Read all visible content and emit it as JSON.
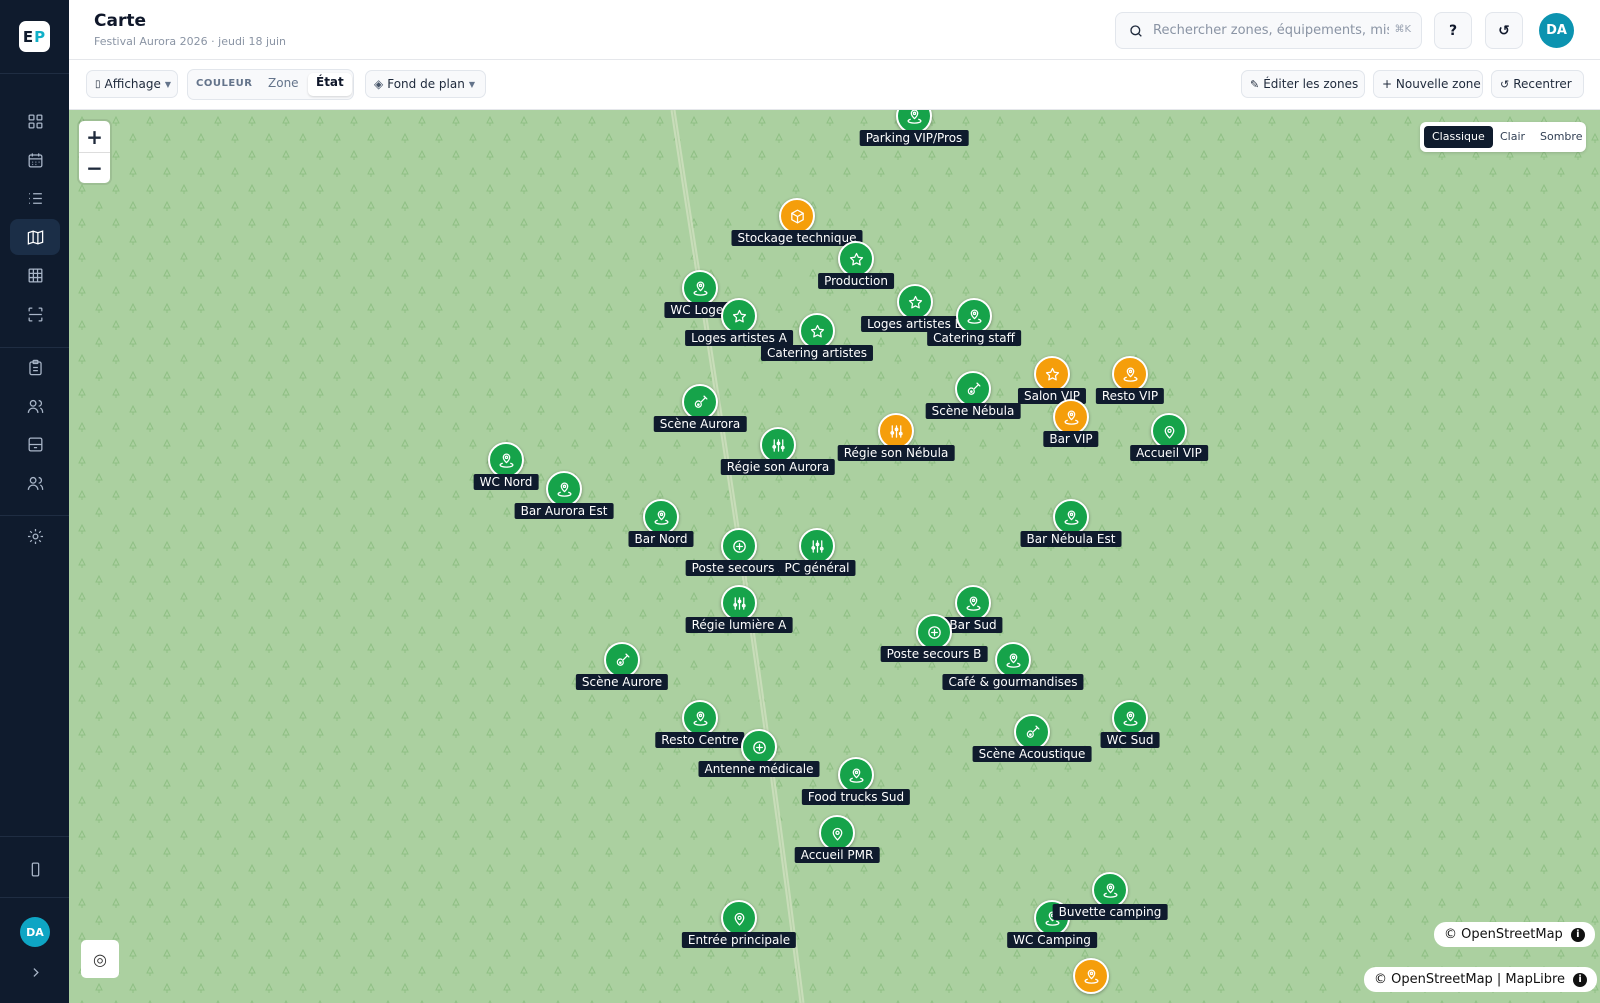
{
  "app": {
    "logo_left": "E",
    "logo_right": "P",
    "user_initials": "DA"
  },
  "header": {
    "title": "Carte",
    "subtitle": "Festival Aurora 2026 · jeudi 18 juin",
    "search_placeholder": "Rechercher zones, équipements, missi",
    "search_shortcut": "⌘K",
    "help_label": "?",
    "refresh_label": "↺",
    "avatar": "DA"
  },
  "toolbar": {
    "display_label": "Affichage",
    "color_label": "COULEUR",
    "color_options": [
      "Zone",
      "État"
    ],
    "color_selected": "État",
    "basemap_label": "Fond de plan",
    "edit_zones": "Éditer les zones",
    "new_zone": "+ Nouvelle zone",
    "recenter": "Recentrer"
  },
  "map": {
    "zoom_in": "+",
    "zoom_out": "−",
    "styles": [
      "Classique",
      "Clair",
      "Sombre"
    ],
    "style_selected": "Classique",
    "attribution_small": "© OpenStreetMap",
    "attribution_full": "© OpenStreetMap | MapLibre",
    "locate_icon": "◎",
    "colors": {
      "ok": "#16a34a",
      "warning": "#f59e0b",
      "background": "#abd0a0",
      "label_bg": "#0f1b2d"
    },
    "markers": [
      {
        "label": "Parking VIP/Pros",
        "status": "ok",
        "icon": "pin"
      },
      {
        "label": "Stockage technique",
        "status": "warning",
        "icon": "box"
      },
      {
        "label": "Production",
        "status": "ok",
        "icon": "star"
      },
      {
        "label": "WC Loges",
        "status": "ok",
        "icon": "pin"
      },
      {
        "label": "Loges artistes A",
        "status": "ok",
        "icon": "star"
      },
      {
        "label": "Catering artistes",
        "status": "ok",
        "icon": "star"
      },
      {
        "label": "Loges artistes B",
        "status": "ok",
        "icon": "star"
      },
      {
        "label": "Catering staff",
        "status": "ok",
        "icon": "pin"
      },
      {
        "label": "Scène Aurora",
        "status": "ok",
        "icon": "guitar"
      },
      {
        "label": "Scène Nébula",
        "status": "ok",
        "icon": "guitar"
      },
      {
        "label": "Salon VIP",
        "status": "warning",
        "icon": "star"
      },
      {
        "label": "Resto VIP",
        "status": "warning",
        "icon": "pin"
      },
      {
        "label": "Bar VIP",
        "status": "warning",
        "icon": "pin"
      },
      {
        "label": "Accueil VIP",
        "status": "ok",
        "icon": "marker"
      },
      {
        "label": "Régie son Aurora",
        "status": "ok",
        "icon": "sliders"
      },
      {
        "label": "Régie son Nébula",
        "status": "warning",
        "icon": "sliders"
      },
      {
        "label": "WC Nord",
        "status": "ok",
        "icon": "pin"
      },
      {
        "label": "Bar Aurora Est",
        "status": "ok",
        "icon": "pin"
      },
      {
        "label": "Bar Nord",
        "status": "ok",
        "icon": "pin"
      },
      {
        "label": "Bar Nébula Est",
        "status": "ok",
        "icon": "pin"
      },
      {
        "label": "Régie lumière A",
        "status": "ok",
        "icon": "sliders"
      },
      {
        "label": "Poste secours A",
        "status": "ok",
        "icon": "plus"
      },
      {
        "label": "PC général",
        "status": "ok",
        "icon": "sliders"
      },
      {
        "label": "Bar Sud",
        "status": "ok",
        "icon": "pin"
      },
      {
        "label": "Poste secours B",
        "status": "ok",
        "icon": "plus"
      },
      {
        "label": "Café & gourmandises",
        "status": "ok",
        "icon": "pin"
      },
      {
        "label": "Scène Aurore",
        "status": "ok",
        "icon": "guitar"
      },
      {
        "label": "Resto Centre",
        "status": "ok",
        "icon": "pin"
      },
      {
        "label": "Antenne médicale",
        "status": "ok",
        "icon": "plus"
      },
      {
        "label": "Scène Acoustique",
        "status": "ok",
        "icon": "guitar"
      },
      {
        "label": "WC Sud",
        "status": "ok",
        "icon": "pin"
      },
      {
        "label": "Food trucks Sud",
        "status": "ok",
        "icon": "pin"
      },
      {
        "label": "Accueil PMR",
        "status": "ok",
        "icon": "marker"
      },
      {
        "label": "Entrée principale",
        "status": "ok",
        "icon": "marker"
      },
      {
        "label": "WC Camping",
        "status": "ok",
        "icon": "pin"
      },
      {
        "label": "Buvette camping",
        "status": "ok",
        "icon": "pin"
      },
      {
        "label": "",
        "status": "warning",
        "icon": "pin"
      }
    ]
  },
  "sidebar": {
    "items": [
      {
        "name": "dashboard",
        "icon": "grid-icon"
      },
      {
        "name": "calendar",
        "icon": "calendar-icon"
      },
      {
        "name": "list",
        "icon": "list-icon"
      },
      {
        "name": "map",
        "icon": "map-icon",
        "active": true
      },
      {
        "name": "table",
        "icon": "table-icon"
      },
      {
        "name": "scan",
        "icon": "scan-icon"
      },
      {
        "name": "clipboard",
        "icon": "clipboard-icon"
      },
      {
        "name": "people",
        "icon": "users-icon"
      },
      {
        "name": "storage",
        "icon": "inbox-icon"
      },
      {
        "name": "team",
        "icon": "team-icon"
      },
      {
        "name": "settings",
        "icon": "gear-icon"
      },
      {
        "name": "mobile",
        "icon": "phone-icon"
      },
      {
        "name": "expand",
        "icon": "chevron-right-icon"
      }
    ]
  }
}
